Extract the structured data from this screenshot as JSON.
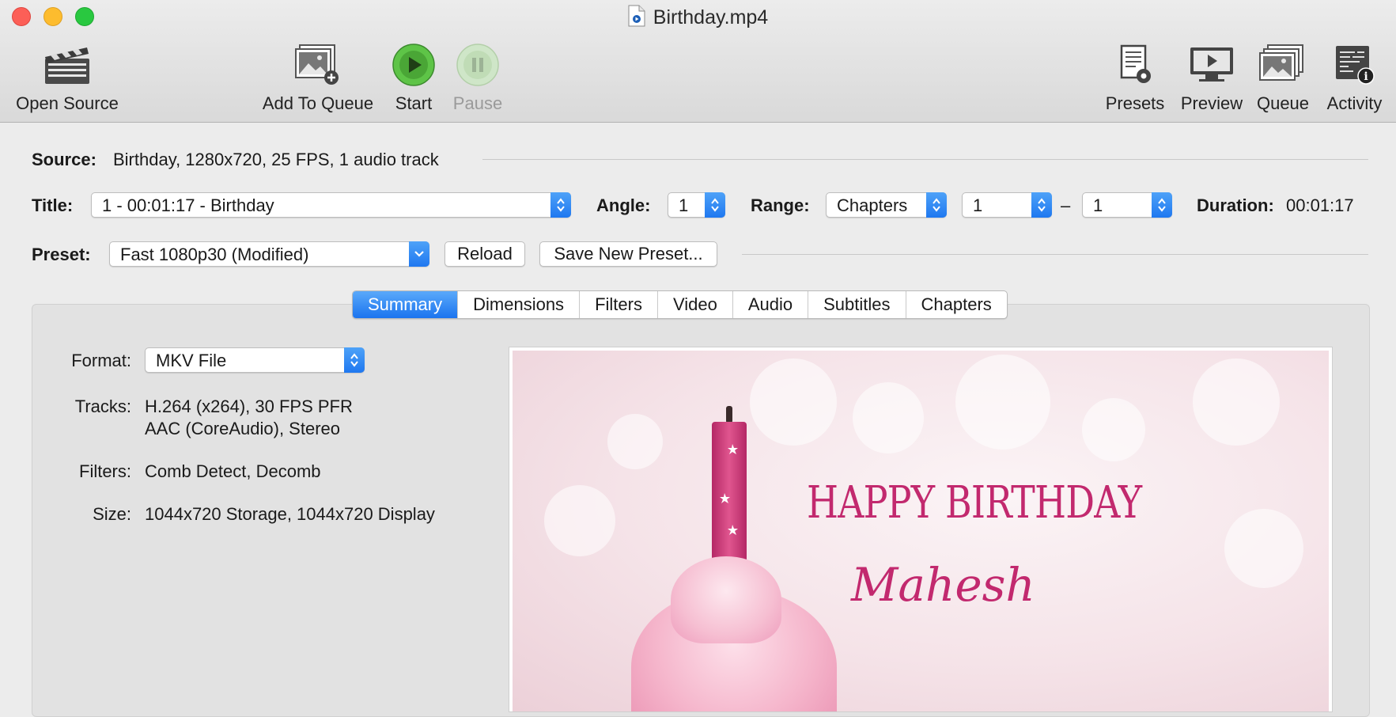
{
  "window": {
    "title": "Birthday.mp4"
  },
  "toolbar": {
    "open_source": "Open Source",
    "add_to_queue": "Add To Queue",
    "start": "Start",
    "pause": "Pause",
    "presets": "Presets",
    "preview": "Preview",
    "queue": "Queue",
    "activity": "Activity"
  },
  "source": {
    "label": "Source:",
    "value": "Birthday, 1280x720, 25 FPS, 1 audio track"
  },
  "title_row": {
    "title_label": "Title:",
    "title_value": "1 - 00:01:17 - Birthday",
    "angle_label": "Angle:",
    "angle_value": "1",
    "range_label": "Range:",
    "range_value": "Chapters",
    "range_start": "1",
    "range_dash": "–",
    "range_end": "1",
    "duration_label": "Duration:",
    "duration_value": "00:01:17"
  },
  "preset_row": {
    "label": "Preset:",
    "value": "Fast 1080p30 (Modified)",
    "reload": "Reload",
    "save_new": "Save New Preset..."
  },
  "tabs": [
    "Summary",
    "Dimensions",
    "Filters",
    "Video",
    "Audio",
    "Subtitles",
    "Chapters"
  ],
  "active_tab": "Summary",
  "summary": {
    "format_label": "Format:",
    "format_value": "MKV File",
    "tracks_label": "Tracks:",
    "tracks_line1": "H.264 (x264), 30 FPS PFR",
    "tracks_line2": "AAC (CoreAudio), Stereo",
    "filters_label": "Filters:",
    "filters_value": "Comb Detect, Decomb",
    "size_label": "Size:",
    "size_value": "1044x720 Storage, 1044x720 Display"
  },
  "preview_image": {
    "headline": "HAPPY BIRTHDAY",
    "name": "Mahesh"
  },
  "colors": {
    "accent": "#1f78f0",
    "close": "#fc5f57",
    "minimize": "#fdbc2e",
    "maximize": "#29c840",
    "start_green": "#4caf3a",
    "birthday_pink": "#c2296e"
  }
}
